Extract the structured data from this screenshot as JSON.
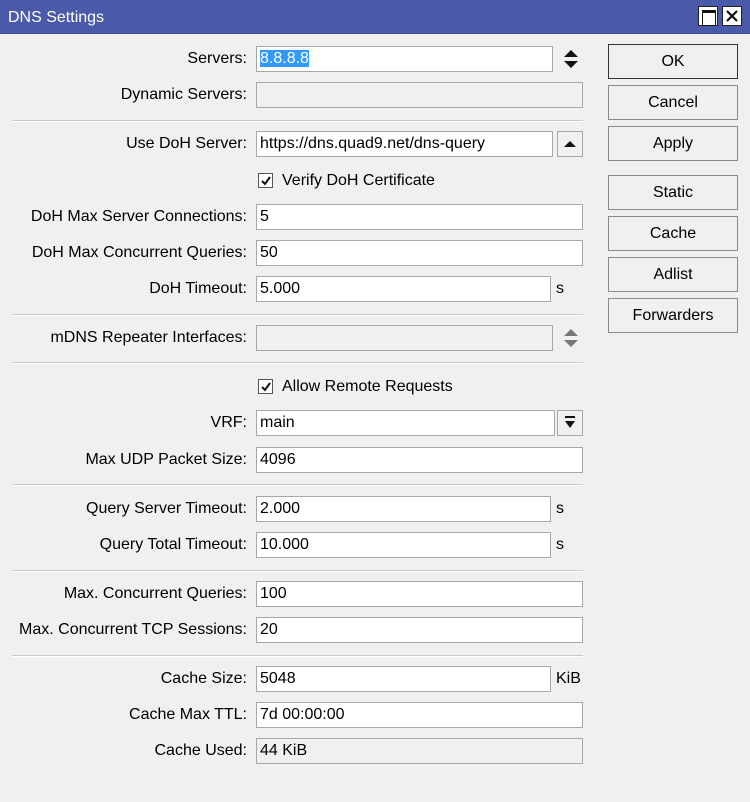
{
  "window": {
    "title": "DNS Settings"
  },
  "servers": {
    "label": "Servers:",
    "value": "8.8.8.8"
  },
  "dynamic_servers": {
    "label": "Dynamic Servers:",
    "value": ""
  },
  "doh_server": {
    "label": "Use DoH Server:",
    "value": "https://dns.quad9.net/dns-query"
  },
  "verify_doh": {
    "label": "Verify DoH Certificate",
    "checked": true
  },
  "doh_max_server_connections": {
    "label": "DoH Max Server Connections:",
    "value": "5"
  },
  "doh_max_concurrent_queries": {
    "label": "DoH Max Concurrent Queries:",
    "value": "50"
  },
  "doh_timeout": {
    "label": "DoH Timeout:",
    "value": "5.000",
    "unit": "s"
  },
  "mdns_repeater": {
    "label": "mDNS Repeater Interfaces:",
    "value": ""
  },
  "allow_remote": {
    "label": "Allow Remote Requests",
    "checked": true
  },
  "vrf": {
    "label": "VRF:",
    "value": "main"
  },
  "max_udp": {
    "label": "Max UDP Packet Size:",
    "value": "4096"
  },
  "query_server_timeout": {
    "label": "Query Server Timeout:",
    "value": "2.000",
    "unit": "s"
  },
  "query_total_timeout": {
    "label": "Query Total Timeout:",
    "value": "10.000",
    "unit": "s"
  },
  "max_concurrent_queries": {
    "label": "Max. Concurrent Queries:",
    "value": "100"
  },
  "max_concurrent_tcp": {
    "label": "Max. Concurrent TCP Sessions:",
    "value": "20"
  },
  "cache_size": {
    "label": "Cache Size:",
    "value": "5048",
    "unit": "KiB"
  },
  "cache_max_ttl": {
    "label": "Cache Max TTL:",
    "value": "7d 00:00:00"
  },
  "cache_used": {
    "label": "Cache Used:",
    "value": "44 KiB"
  },
  "buttons": {
    "ok": "OK",
    "cancel": "Cancel",
    "apply": "Apply",
    "static": "Static",
    "cache": "Cache",
    "adlist": "Adlist",
    "forwarders": "Forwarders"
  },
  "colors": {
    "titlebar": "#4a5aa8",
    "selection": "#3399ff",
    "background": "#f0f0f0"
  }
}
